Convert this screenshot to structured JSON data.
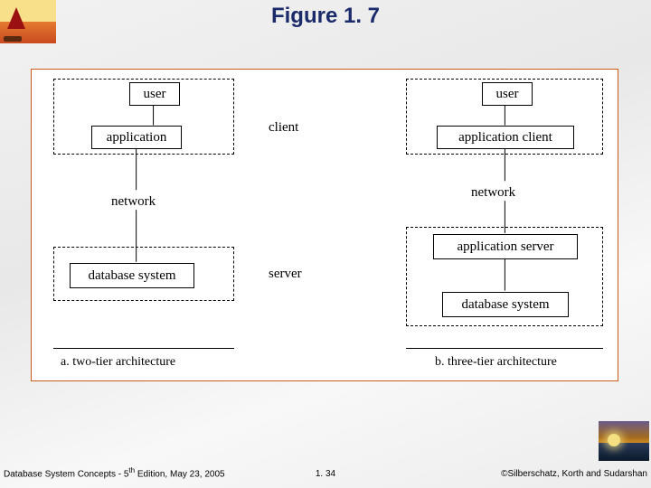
{
  "header": {
    "title": "Figure 1. 7"
  },
  "diagram": {
    "left": {
      "user": "user",
      "application": "application",
      "client_label": "client",
      "network_label": "network",
      "database_system": "database system",
      "server_label": "server",
      "caption": "a.   two-tier architecture"
    },
    "right": {
      "user": "user",
      "application_client": "application client",
      "network_label": "network",
      "application_server": "application server",
      "database_system": "database system",
      "caption": "b.   three-tier architecture"
    }
  },
  "footer": {
    "left_prefix": "Database System Concepts - 5",
    "left_suffix": " Edition, May 23,  2005",
    "left_sup": "th",
    "center": "1. 34",
    "right": "©Silberschatz, Korth and Sudarshan"
  },
  "icons": {
    "logo_left": "sailboat-sunset-icon",
    "logo_right": "sunset-water-icon"
  }
}
